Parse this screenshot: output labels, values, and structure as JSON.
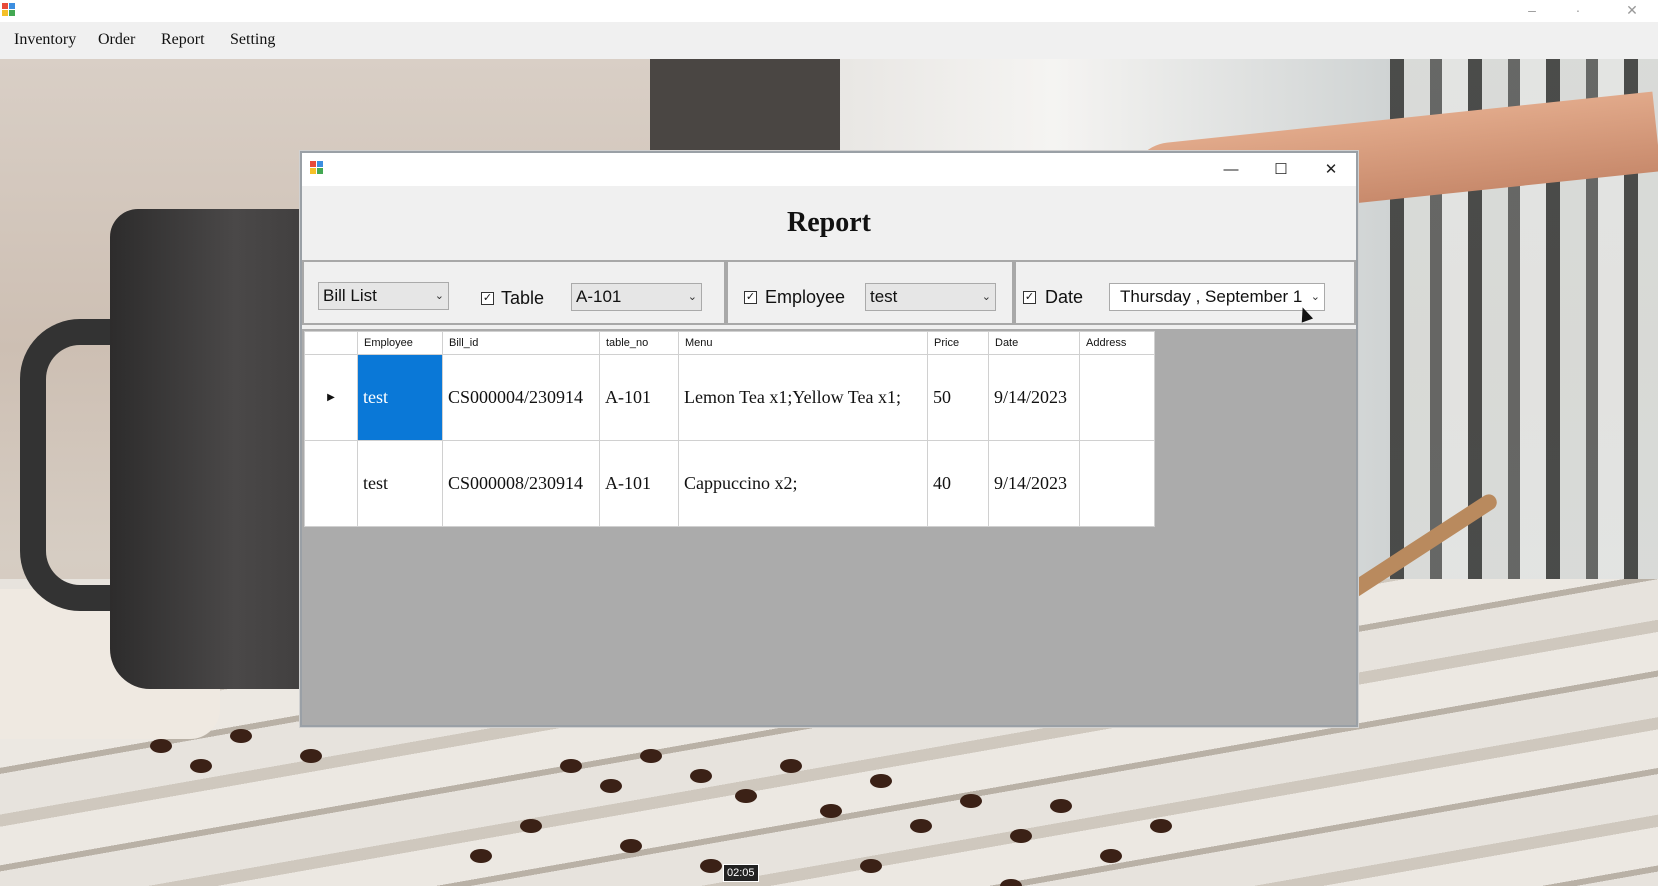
{
  "main_window": {
    "menu": [
      "Inventory",
      "Order",
      "Report",
      "Setting"
    ],
    "controls": {
      "minimize": "–",
      "restore": "·",
      "close": "✕"
    }
  },
  "report_window": {
    "heading": "Report",
    "controls": {
      "minimize": "—",
      "maximize": "☐",
      "close": "✕"
    },
    "filters": {
      "report_type": "Bill List",
      "table_checkbox_checked": true,
      "table_label": "Table",
      "table_value": "A-101",
      "employee_checkbox_checked": true,
      "employee_label": "Employee",
      "employee_value": "test",
      "date_checkbox_checked": true,
      "date_label": "Date",
      "date_value": "Thursday  , September 1"
    },
    "grid": {
      "columns": [
        "Employee",
        "Bill_id",
        "table_no",
        "Menu",
        "Price",
        "Date",
        "Address"
      ],
      "rows": [
        {
          "current": true,
          "Employee": "test",
          "Bill_id": "CS000004/230914",
          "table_no": "A-101",
          "Menu": "Lemon Tea x1;Yellow Tea x1;",
          "Price": "50",
          "Date": "9/14/2023",
          "Address": ""
        },
        {
          "current": false,
          "Employee": "test",
          "Bill_id": "CS000008/230914",
          "table_no": "A-101",
          "Menu": "Cappuccino x2;",
          "Price": "40",
          "Date": "9/14/2023",
          "Address": ""
        }
      ]
    }
  },
  "video_timestamp": "02:05",
  "icons": {
    "row_pointer": "row-pointer-icon",
    "dropdown": "chevron-down-icon",
    "check": "checkmark-icon"
  }
}
